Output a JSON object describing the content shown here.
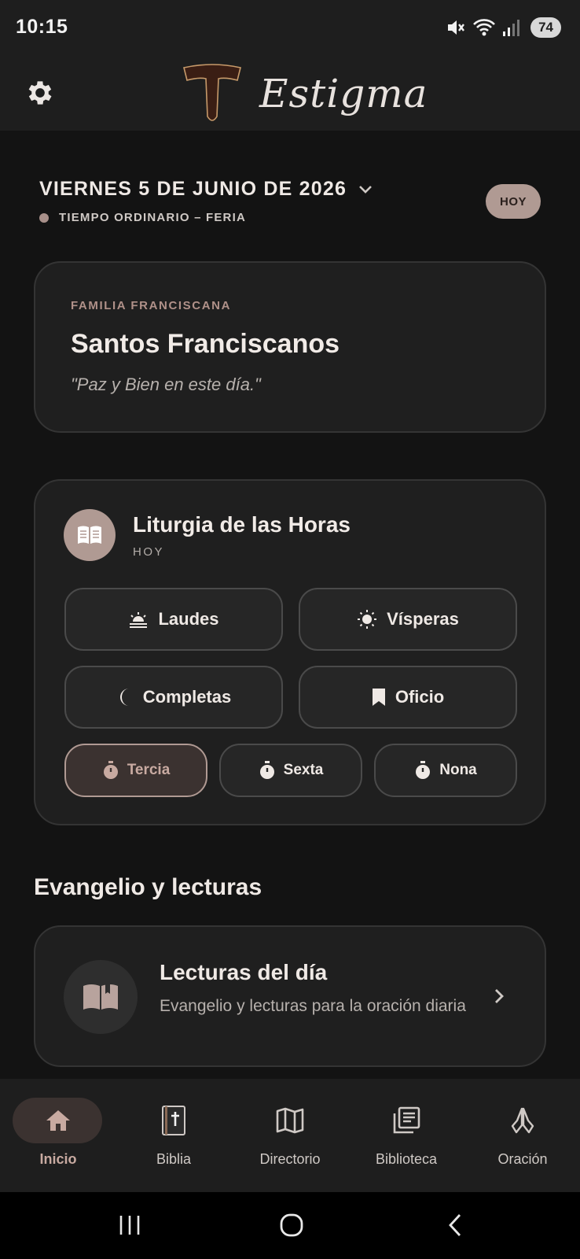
{
  "status_bar": {
    "time": "10:15",
    "battery": "74"
  },
  "header": {
    "app_name": "Estigma",
    "settings_icon": "gear-icon",
    "logo_icon": "tau-cross-icon"
  },
  "date": {
    "label": "VIERNES 5 DE JUNIO DE 2026",
    "season": "TIEMPO ORDINARIO – FERIA",
    "today_button": "HOY",
    "season_color": "#a8908a"
  },
  "saint_card": {
    "kicker": "FAMILIA FRANCISCANA",
    "title": "Santos Franciscanos",
    "quote": "\"Paz y Bien en este día.\""
  },
  "liturgy": {
    "title": "Liturgia de las Horas",
    "subtitle": "HOY",
    "icon": "open-book-icon",
    "hours": [
      {
        "label": "Laudes",
        "icon": "sunrise-icon"
      },
      {
        "label": "Vísperas",
        "icon": "sun-icon"
      },
      {
        "label": "Completas",
        "icon": "moon-icon"
      },
      {
        "label": "Oficio",
        "icon": "bookmark-icon"
      }
    ],
    "minor_hours": [
      {
        "label": "Tercia",
        "icon": "stopwatch-icon",
        "active": true
      },
      {
        "label": "Sexta",
        "icon": "stopwatch-icon",
        "active": false
      },
      {
        "label": "Nona",
        "icon": "stopwatch-icon",
        "active": false
      }
    ]
  },
  "readings_section": {
    "title": "Evangelio y lecturas",
    "card_title": "Lecturas del día",
    "card_desc": "Evangelio y lecturas para la oración diaria"
  },
  "bottom_nav": [
    {
      "label": "Inicio",
      "icon": "home-icon",
      "active": true
    },
    {
      "label": "Biblia",
      "icon": "bible-icon",
      "active": false
    },
    {
      "label": "Directorio",
      "icon": "map-icon",
      "active": false
    },
    {
      "label": "Biblioteca",
      "icon": "library-icon",
      "active": false
    },
    {
      "label": "Oración",
      "icon": "praying-hands-icon",
      "active": false
    }
  ],
  "colors": {
    "accent": "#b09a93",
    "background": "#131313",
    "surface": "#1f1f1f"
  }
}
